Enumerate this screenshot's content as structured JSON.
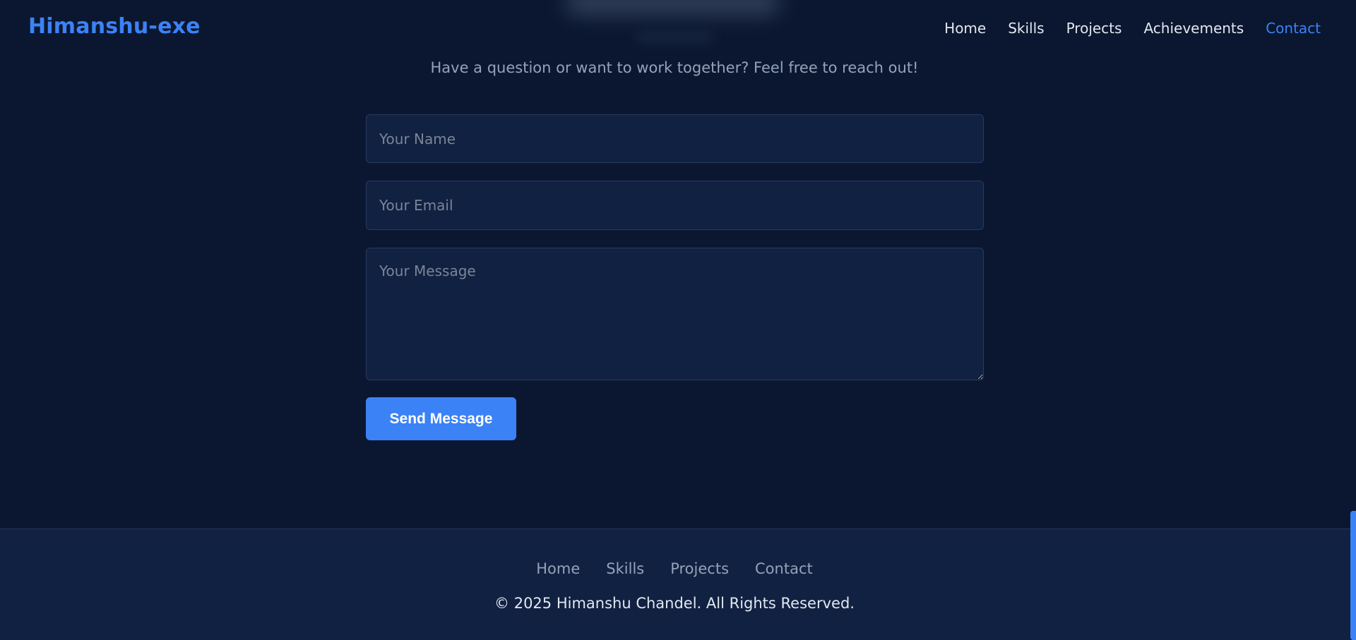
{
  "header": {
    "brand": "Himanshu-exe",
    "nav": [
      {
        "label": "Home"
      },
      {
        "label": "Skills"
      },
      {
        "label": "Projects"
      },
      {
        "label": "Achievements"
      },
      {
        "label": "Contact",
        "active": true
      }
    ]
  },
  "contact": {
    "subtitle": "Have a question or want to work together? Feel free to reach out!",
    "name_placeholder": "Your Name",
    "email_placeholder": "Your Email",
    "message_placeholder": "Your Message",
    "send_label": "Send Message"
  },
  "footer": {
    "nav": [
      {
        "label": "Home"
      },
      {
        "label": "Skills"
      },
      {
        "label": "Projects"
      },
      {
        "label": "Contact"
      }
    ],
    "copyright": "© 2025 Himanshu Chandel. All Rights Reserved."
  },
  "colors": {
    "accent": "#3b82f6",
    "background": "#0b1730",
    "surface": "#112142"
  }
}
